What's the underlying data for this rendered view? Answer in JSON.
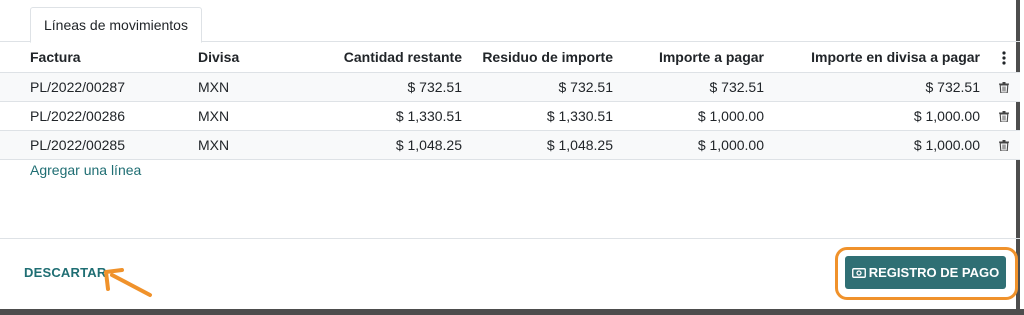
{
  "tab": {
    "label": "Líneas de movimientos"
  },
  "table": {
    "headers": {
      "factura": "Factura",
      "divisa": "Divisa",
      "cantidad_restante": "Cantidad restante",
      "residuo_importe": "Residuo de importe",
      "importe_pagar": "Importe a pagar",
      "importe_divisa": "Importe en divisa a pagar"
    },
    "rows": [
      {
        "factura": "PL/2022/00287",
        "divisa": "MXN",
        "cantidad_restante": "$ 732.51",
        "residuo_importe": "$ 732.51",
        "importe_pagar": "$ 732.51",
        "importe_divisa": "$ 732.51"
      },
      {
        "factura": "PL/2022/00286",
        "divisa": "MXN",
        "cantidad_restante": "$ 1,330.51",
        "residuo_importe": "$ 1,330.51",
        "importe_pagar": "$ 1,000.00",
        "importe_divisa": "$ 1,000.00"
      },
      {
        "factura": "PL/2022/00285",
        "divisa": "MXN",
        "cantidad_restante": "$ 1,048.25",
        "residuo_importe": "$ 1,048.25",
        "importe_pagar": "$ 1,000.00",
        "importe_divisa": "$ 1,000.00"
      }
    ]
  },
  "add_line": "Agregar una línea",
  "footer": {
    "discard": "DESCARTAR",
    "register_payment": "REGISTRO DE PAGO"
  },
  "colors": {
    "accent": "#1f6e73",
    "button": "#2f6f74",
    "highlight": "#f0922b"
  },
  "icons": [
    "trash-icon",
    "kebab-menu-icon",
    "money-icon",
    "arrow-annotation"
  ]
}
